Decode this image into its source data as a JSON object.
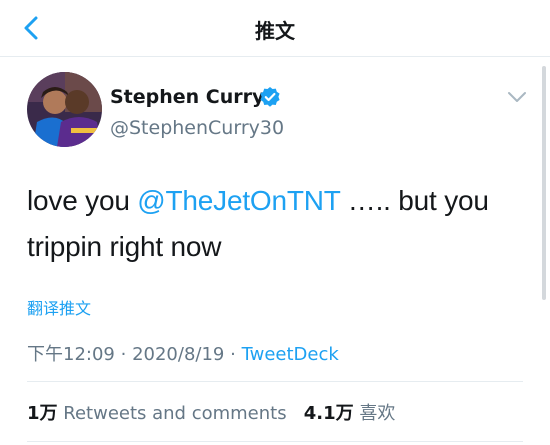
{
  "header": {
    "title": "推文"
  },
  "tweet": {
    "author": {
      "display_name": "Stephen Curry",
      "handle": "@StephenCurry30"
    },
    "text": {
      "before": "love you ",
      "mention": "@TheJetOnTNT",
      "after": " ….. but you trippin right now"
    },
    "translate_label": "翻译推文",
    "meta": {
      "time": "下午12:09",
      "separator": "·",
      "date": "2020/8/19",
      "source": "TweetDeck"
    },
    "stats": {
      "retweets_count": "1万",
      "retweets_label": "Retweets and comments",
      "likes_count": "4.1万",
      "likes_label": "喜欢"
    }
  },
  "colors": {
    "accent": "#1da1f2",
    "secondary_text": "#657786",
    "divider": "#e6ecf0"
  },
  "icons": {
    "back": "chevron-left-icon",
    "verified": "verified-badge-icon",
    "menu": "chevron-down-icon"
  }
}
